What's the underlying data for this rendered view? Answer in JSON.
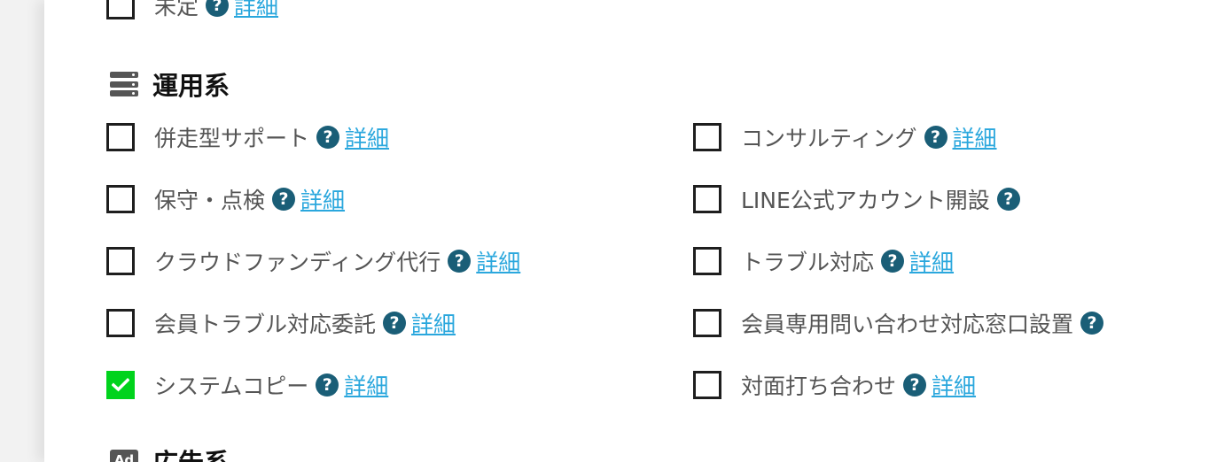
{
  "top_partial_item": {
    "label": "未定",
    "detail": "詳細",
    "checked": false
  },
  "sections": {
    "operations": {
      "title": "運用系",
      "icon": "server-icon",
      "left_items": [
        {
          "label": "併走型サポート",
          "detail": "詳細",
          "checked": false
        },
        {
          "label": "保守・点検",
          "detail": "詳細",
          "checked": false
        },
        {
          "label": "クラウドファンディング代行",
          "detail": "詳細",
          "checked": false
        },
        {
          "label": "会員トラブル対応委託",
          "detail": "詳細",
          "checked": false
        },
        {
          "label": "システムコピー",
          "detail": "詳細",
          "checked": true
        }
      ],
      "right_items": [
        {
          "label": "コンサルティング",
          "detail": "詳細",
          "checked": false
        },
        {
          "label": "LINE公式アカウント開設",
          "detail": null,
          "checked": false
        },
        {
          "label": "トラブル対応",
          "detail": "詳細",
          "checked": false
        },
        {
          "label": "会員専用問い合わせ対応窓口設置",
          "detail": null,
          "checked": false
        },
        {
          "label": "対面打ち合わせ",
          "detail": "詳細",
          "checked": false
        }
      ]
    },
    "advertising": {
      "title": "広告系",
      "icon": "ad-icon",
      "icon_text": "Ad"
    }
  },
  "help_glyph": "?",
  "colors": {
    "checkbox_checked": "#00d31c",
    "help_icon": "#1a5e77",
    "link": "#2aa7dd"
  }
}
